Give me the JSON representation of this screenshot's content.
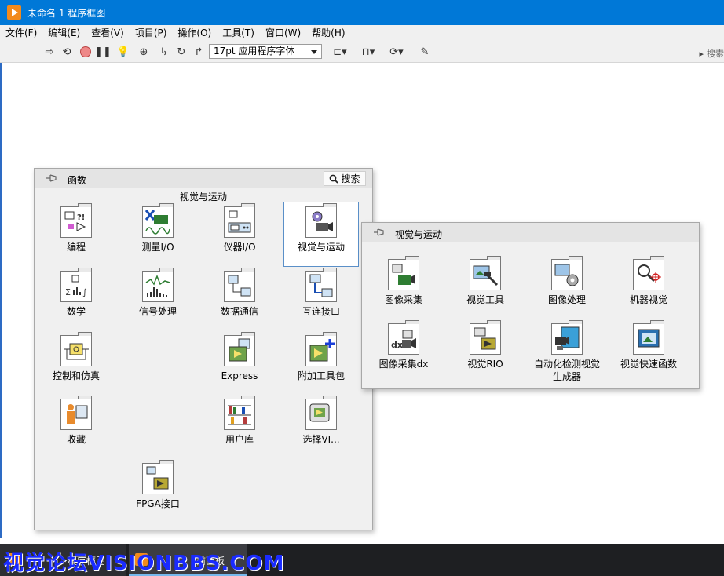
{
  "window": {
    "title": "未命名 1 程序框图"
  },
  "menu": [
    "文件(F)",
    "编辑(E)",
    "查看(V)",
    "项目(P)",
    "操作(O)",
    "工具(T)",
    "窗口(W)",
    "帮助(H)"
  ],
  "toolbar": {
    "font": "17pt 应用程序字体",
    "search_placeholder": "搜索"
  },
  "functions_palette": {
    "title": "函数",
    "search_label": "搜索",
    "category": "视觉与运动",
    "items": [
      {
        "label": "编程",
        "icon": "programming-icon"
      },
      {
        "label": "测量I/O",
        "icon": "measurement-io-icon"
      },
      {
        "label": "仪器I/O",
        "icon": "instrument-io-icon"
      },
      {
        "label": "视觉与运动",
        "icon": "vision-motion-icon"
      },
      {
        "label": "数学",
        "icon": "math-icon"
      },
      {
        "label": "信号处理",
        "icon": "signal-processing-icon"
      },
      {
        "label": "数据通信",
        "icon": "data-communication-icon"
      },
      {
        "label": "互连接口",
        "icon": "connectivity-icon"
      },
      {
        "label": "控制和仿真",
        "icon": "control-simulation-icon"
      },
      {
        "label": "Express",
        "icon": "express-icon"
      },
      {
        "label": "附加工具包",
        "icon": "addons-icon"
      },
      {
        "label": "收藏",
        "icon": "favorites-icon"
      },
      {
        "label": "用户库",
        "icon": "user-libraries-icon"
      },
      {
        "label": "选择VI...",
        "icon": "select-vi-icon"
      },
      {
        "label": "FPGA接口",
        "icon": "fpga-interface-icon"
      }
    ]
  },
  "vision_palette": {
    "title": "视觉与运动",
    "items": [
      {
        "label": "图像采集",
        "icon": "image-acquisition-icon"
      },
      {
        "label": "视觉工具",
        "icon": "vision-utilities-icon"
      },
      {
        "label": "图像处理",
        "icon": "image-processing-icon"
      },
      {
        "label": "机器视觉",
        "icon": "machine-vision-icon"
      },
      {
        "label": "图像采集dx",
        "icon": "image-acquisition-dx-icon"
      },
      {
        "label": "视觉RIO",
        "icon": "vision-rio-icon"
      },
      {
        "label": "自动化检测视觉生成器",
        "icon": "vision-builder-ai-icon"
      },
      {
        "label": "视觉快速函数",
        "icon": "vision-express-icon"
      }
    ]
  },
  "taskbar": {
    "task1": "程序框图",
    "task2": "前面板"
  },
  "watermark": "视觉论坛VISIONBBS.COM"
}
